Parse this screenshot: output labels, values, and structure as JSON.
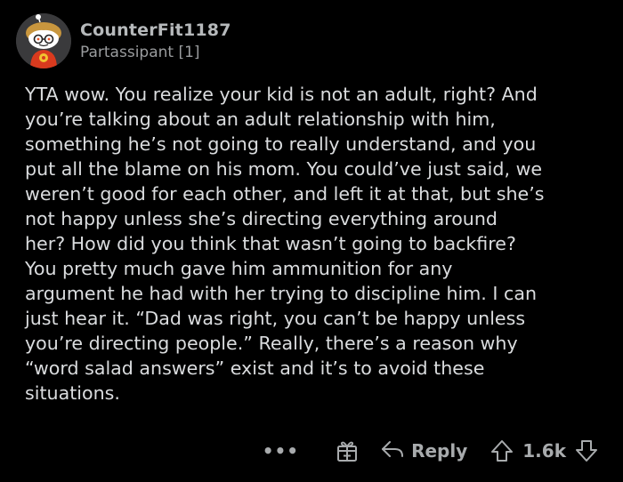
{
  "comment": {
    "author": "CounterFit1187",
    "flair": "Partassipant [1]",
    "body_lines": [
      "YTA wow. You realize your kid is not an adult, right? And",
      "you’re talking about an adult relationship with him,",
      "something he’s not going to really understand, and you",
      "put all the blame on his mom. You could’ve just said, we",
      "weren’t good for each other, and left it at that, but she’s",
      "not happy unless she’s directing everything around",
      "her? How did you think that wasn’t going to backfire?",
      "You pretty much gave him ammunition for any",
      "argument he had with her trying to discipline him. I can",
      "just hear it. “Dad was right, you can’t be happy unless",
      "you’re directing people.” Really, there’s a reason why",
      "“word salad answers” exist and it’s to avoid these",
      "situations."
    ]
  },
  "actions": {
    "more_label": "•••",
    "reply_label": "Reply",
    "score": "1.6k"
  },
  "icons": {
    "more": "more-dots-icon",
    "award": "gift-award-icon",
    "reply": "reply-arrow-icon",
    "upvote": "upvote-arrow-icon",
    "downvote": "downvote-arrow-icon"
  },
  "colors": {
    "background": "#000000",
    "body_text": "#dadcde",
    "username": "#b6b9bb",
    "flair": "#9a9c9e",
    "actions": "#a8abad"
  }
}
